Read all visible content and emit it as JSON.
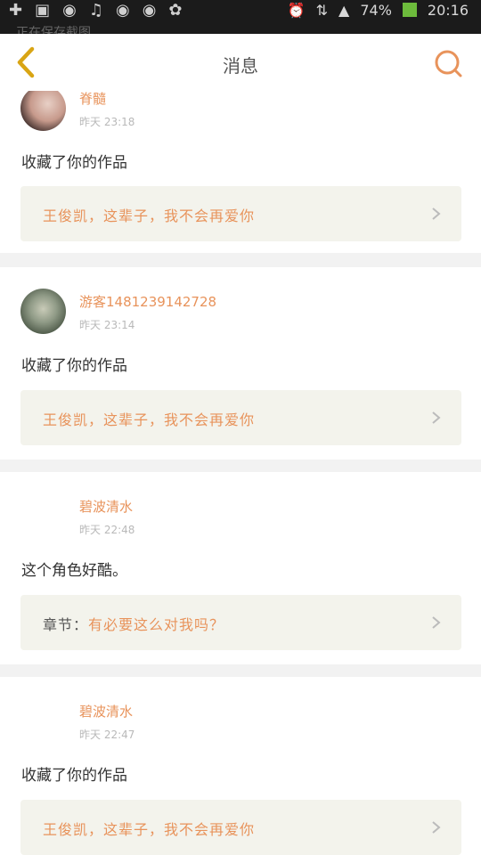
{
  "status": {
    "battery_percent": "74%",
    "time": "20:16",
    "notice": "正在保存截图..."
  },
  "header": {
    "title": "消息",
    "accent": "#e8935b",
    "back_color": "#d9a514"
  },
  "messages": [
    {
      "name": "脊髓",
      "time": "昨天 23:18",
      "action": "收藏了你的作品",
      "target_prefix": "",
      "target": "王俊凯，这辈子，我不会再爱你"
    },
    {
      "name": "游客1481239142728",
      "time": "昨天 23:14",
      "action": "收藏了你的作品",
      "target_prefix": "",
      "target": "王俊凯，这辈子，我不会再爱你"
    },
    {
      "name": "碧波清水",
      "time": "昨天 22:48",
      "action": "这个角色好酷。",
      "target_prefix": "章节：",
      "target": "有必要这么对我吗？"
    },
    {
      "name": "碧波清水",
      "time": "昨天 22:47",
      "action": "收藏了你的作品",
      "target_prefix": "",
      "target": "王俊凯，这辈子，我不会再爱你"
    }
  ]
}
